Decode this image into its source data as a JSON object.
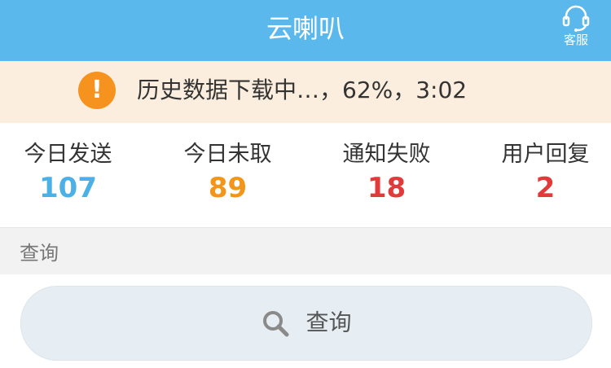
{
  "header": {
    "title": "云喇叭",
    "support_label": "客服"
  },
  "banner": {
    "message": "历史数据下载中…，62%，3:02",
    "icon": "exclamation-icon",
    "icon_text": "!",
    "progress_percent": 62,
    "remaining": "3:02"
  },
  "stats": [
    {
      "label": "今日发送",
      "value": "107",
      "color": "#4ab0e6"
    },
    {
      "label": "今日未取",
      "value": "89",
      "color": "#f29518"
    },
    {
      "label": "通知失败",
      "value": "18",
      "color": "#e23a3a"
    },
    {
      "label": "用户回复",
      "value": "2",
      "color": "#e23a3a"
    }
  ],
  "query_section": {
    "title": "查询",
    "button_label": "查询",
    "button_icon": "search-icon"
  },
  "colors": {
    "header_bg": "#5ab8ec",
    "banner_bg": "#fbeede",
    "warning": "#f6921e"
  }
}
